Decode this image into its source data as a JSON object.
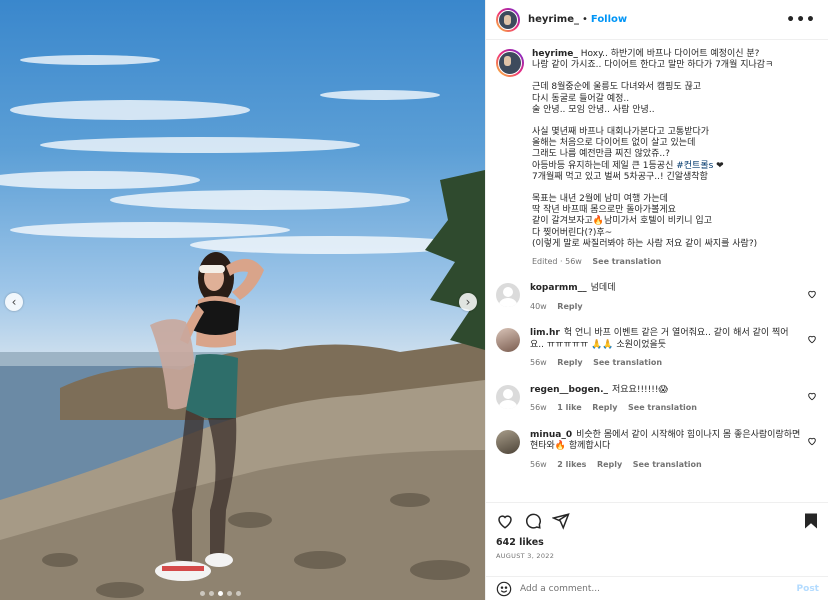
{
  "post": {
    "username": "heyrime_",
    "follow_label": "Follow",
    "separator": "•"
  },
  "caption": {
    "username": "heyrime_",
    "lines": [
      "Hoxy.. 하반기에 바프나 다이어트 예정이신 분?",
      "나랑 같이 가시죠.. 다이어트 한다고 말만 하다가 7개월 지나감ㅋ",
      "",
      "근데 8월중순에 울릉도 다녀와서 캠핑도 끊고",
      "다시 동굴로 들어갈 예정..",
      "술 안녕.. 모임 안녕.. 사람 안녕..",
      "",
      "사실 몇년째 바프나 대회나가본다고 고통받다가",
      "올해는 처음으로 다이어트 없이 살고 있는데",
      "그래도 나름 예전만큼 찌진 않았쥬..?",
      "아등바등 유지하는데 제일 큰 1등공신 #컨트롤s ❤",
      "7개월째 먹고 있고 벌써 5차공구..! 긴알생착함",
      "",
      "목표는 내년 2월에 남미 여행 가는데",
      "딱 작년 바프때 몸으로만 돌아가볼게요",
      "같이 갈겨보자고🔥남미가서 호텔이 비키니 입고",
      "다 찢어버린다(?)후~",
      "(이렇게 말로 싸질러봐야 하는 사람 저요 같이 싸지를 사람?)"
    ],
    "hashtag": "#컨트롤s",
    "edited": "Edited · 56w",
    "see_translation": "See translation"
  },
  "comments": [
    {
      "username": "koparmm__",
      "text": "넘데데",
      "time": "40w",
      "likes": "",
      "reply": "Reply",
      "translation": "",
      "avatar": "gray"
    },
    {
      "username": "lim.hr",
      "text": "헉 언니 바프 이벤트 같은 거 열어줘요.. 같이 해서 같이 찍어요.. ㅠㅠㅠㅠㅠ 🙏🙏 소원이었을듯",
      "time": "56w",
      "likes": "",
      "reply": "Reply",
      "translation": "See translation",
      "avatar": "photo1"
    },
    {
      "username": "regen__bogen._",
      "text": "저요요!!!!!!😱",
      "time": "56w",
      "likes": "1 like",
      "reply": "Reply",
      "translation": "See translation",
      "avatar": "gray"
    },
    {
      "username": "minua_0",
      "text": "비슷한 몸에서 같이 시작해야 힘이나지 몸 좋은사람이랑하면 현타와🔥 함께합시다",
      "time": "56w",
      "likes": "2 likes",
      "reply": "Reply",
      "translation": "See translation",
      "avatar": "photo2"
    }
  ],
  "actions": {
    "likes": "642 likes",
    "date": "AUGUST 3, 2022"
  },
  "add_comment": {
    "placeholder": "Add a comment...",
    "post_label": "Post"
  },
  "carousel": {
    "prev": "‹",
    "next": "›",
    "dot_count": 5,
    "active_dot": 2
  }
}
